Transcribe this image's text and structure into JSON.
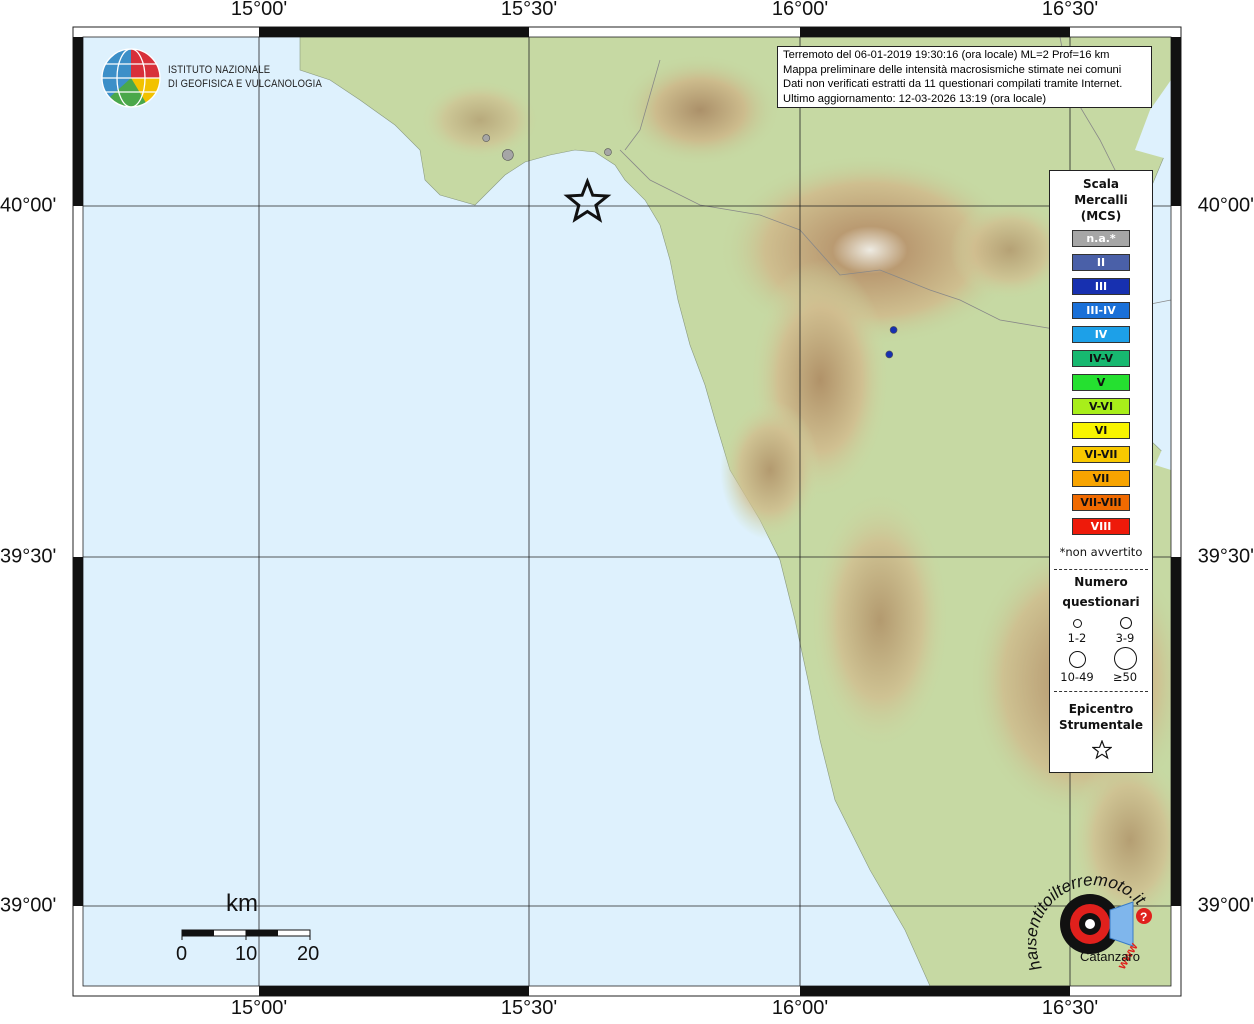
{
  "map": {
    "lon_ticks": [
      "15°00'",
      "15°30'",
      "16°00'",
      "16°30'"
    ],
    "lat_ticks": [
      "40°00'",
      "39°30'",
      "39°00'"
    ],
    "epicenter": {
      "lon": 15.607,
      "lat": 40.005
    },
    "felt_points": [
      {
        "lon": 15.42,
        "lat": 40.097,
        "intensity": "n.a.*",
        "questionnaires": "1-2"
      },
      {
        "lon": 15.46,
        "lat": 40.073,
        "intensity": "n.a.*",
        "questionnaires": "3-9"
      },
      {
        "lon": 15.645,
        "lat": 40.077,
        "intensity": "n.a.*",
        "questionnaires": "1-2"
      },
      {
        "lon": 16.173,
        "lat": 39.823,
        "intensity": "III",
        "questionnaires": "1-2"
      },
      {
        "lon": 16.165,
        "lat": 39.788,
        "intensity": "III",
        "questionnaires": "1-2"
      }
    ],
    "colors": {
      "sea": "#def1fd",
      "land_low": "#b9d59f",
      "land_mid": "#d4c08e",
      "land_high": "#b38f67",
      "peak": "#f2eee8"
    }
  },
  "logo": {
    "line1": "ISTITUTO NAZIONALE",
    "line2": "DI GEOFISICA E VULCANOLOGIA"
  },
  "info": {
    "lines": [
      "Terremoto del 06-01-2019 19:30:16 (ora locale) ML=2 Prof=16 km",
      "Mappa preliminare delle intensità macrosismiche stimate nei comuni",
      "Dati non verificati estratti da 11 questionari compilati tramite Internet.",
      "Ultimo aggiornamento: 12-03-2026 13:19 (ora locale)"
    ]
  },
  "legend": {
    "title": [
      "Scala",
      "Mercalli",
      "(MCS)"
    ],
    "scale": [
      {
        "label": "n.a.*",
        "color": "#a6a6a6",
        "text": "#ffffff"
      },
      {
        "label": "II",
        "color": "#4a60a8",
        "text": "#ffffff"
      },
      {
        "label": "III",
        "color": "#1730b0",
        "text": "#ffffff"
      },
      {
        "label": "III-IV",
        "color": "#1a70d8",
        "text": "#ffffff"
      },
      {
        "label": "IV",
        "color": "#1da0e8",
        "text": "#ffffff"
      },
      {
        "label": "IV-V",
        "color": "#17b870",
        "text": "#111111"
      },
      {
        "label": "V",
        "color": "#25e030",
        "text": "#111111"
      },
      {
        "label": "V-VI",
        "color": "#a8ee1a",
        "text": "#111111"
      },
      {
        "label": "VI",
        "color": "#f8f400",
        "text": "#111111"
      },
      {
        "label": "VI-VII",
        "color": "#f8c800",
        "text": "#111111"
      },
      {
        "label": "VII",
        "color": "#f8a400",
        "text": "#111111"
      },
      {
        "label": "VII-VIII",
        "color": "#f06a00",
        "text": "#111111"
      },
      {
        "label": "VIII",
        "color": "#ee1a0a",
        "text": "#ffffff"
      }
    ],
    "note": "*non avvertito",
    "count_title": [
      "Numero",
      "questionari"
    ],
    "counts": [
      "1-2",
      "3-9",
      "10-49",
      "≥50"
    ],
    "epicenter_title": [
      "Epicentro",
      "Strumentale"
    ]
  },
  "scalebar": {
    "unit": "km",
    "ticks": [
      "0",
      "10",
      "20"
    ]
  },
  "watermark": {
    "brand": "haisentitoilterremoto.it",
    "www": "www",
    "city": "Catanzaro"
  }
}
